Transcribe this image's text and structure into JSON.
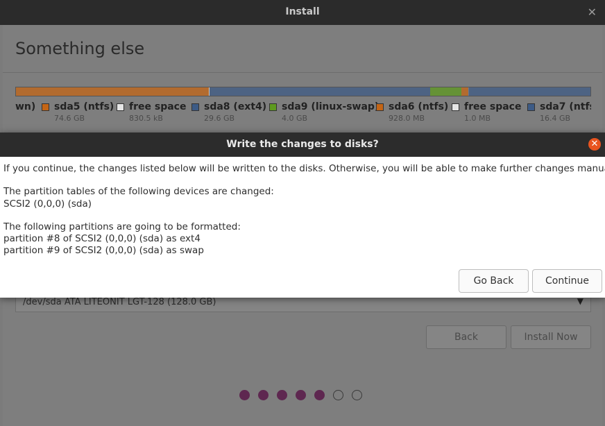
{
  "window": {
    "title": "Install",
    "close_glyph": "✕"
  },
  "page": {
    "title": "Something else"
  },
  "partition_bar": {
    "segments": [
      {
        "name": "sda5 (ntfs)",
        "color": "#c46515",
        "fraction": 0.336
      },
      {
        "name": "free space",
        "color": "#e6e6e6",
        "fraction": 0.001
      },
      {
        "name": "sda8 (ext4)",
        "color": "#3d5b86",
        "fraction": 0.384
      },
      {
        "name": "sda9 (linux-swap)",
        "color": "#5e9a1f",
        "fraction": 0.054
      },
      {
        "name": "sda6 (ntfs)",
        "color": "#c46515",
        "fraction": 0.012
      },
      {
        "name": "free space",
        "color": "#e6e6e6",
        "fraction": 0.001
      },
      {
        "name": "sda7 (ntfs)",
        "color": "#3d5b86",
        "fraction": 0.212
      }
    ]
  },
  "legend": {
    "items": [
      {
        "name": "wn)",
        "size": "",
        "color": ""
      },
      {
        "name": "sda5 (ntfs)",
        "size": "74.6 GB",
        "color": "#c46515"
      },
      {
        "name": "free space",
        "size": "830.5 kB",
        "color": "#e6e6e6"
      },
      {
        "name": "sda8 (ext4)",
        "size": "29.6 GB",
        "color": "#3d5b86"
      },
      {
        "name": "sda9 (linux-swap)",
        "size": "4.0 GB",
        "color": "#5e9a1f"
      },
      {
        "name": "sda6 (ntfs)",
        "size": "928.0 MB",
        "color": "#c46515"
      },
      {
        "name": "free space",
        "size": "1.0 MB",
        "color": "#e6e6e6"
      },
      {
        "name": "sda7 (ntfs)",
        "size": "16.4 GB",
        "color": "#3d5b86"
      }
    ]
  },
  "bootloader_device": {
    "value": "/dev/sda   ATA LITEONIT LGT-128 (128.0 GB)",
    "caret": "▼"
  },
  "buttons": {
    "back": "Back",
    "install_now": "Install Now"
  },
  "progress": {
    "total_steps": 7,
    "completed_steps": 5,
    "active_color": "#5e2750"
  },
  "dialog": {
    "title": "Write the changes to disks?",
    "close_glyph": "✕",
    "intro": "If you continue, the changes listed below will be written to the disks. Otherwise, you will be able to make further changes manually.",
    "tables_heading": "The partition tables of the following devices are changed:",
    "tables_items": [
      " SCSI2 (0,0,0) (sda)"
    ],
    "format_heading": "The following partitions are going to be formatted:",
    "format_items": [
      " partition #8 of SCSI2 (0,0,0) (sda) as ext4",
      " partition #9 of SCSI2 (0,0,0) (sda) as swap"
    ],
    "go_back": "Go Back",
    "continue": "Continue",
    "accent_color": "#e9541f"
  }
}
